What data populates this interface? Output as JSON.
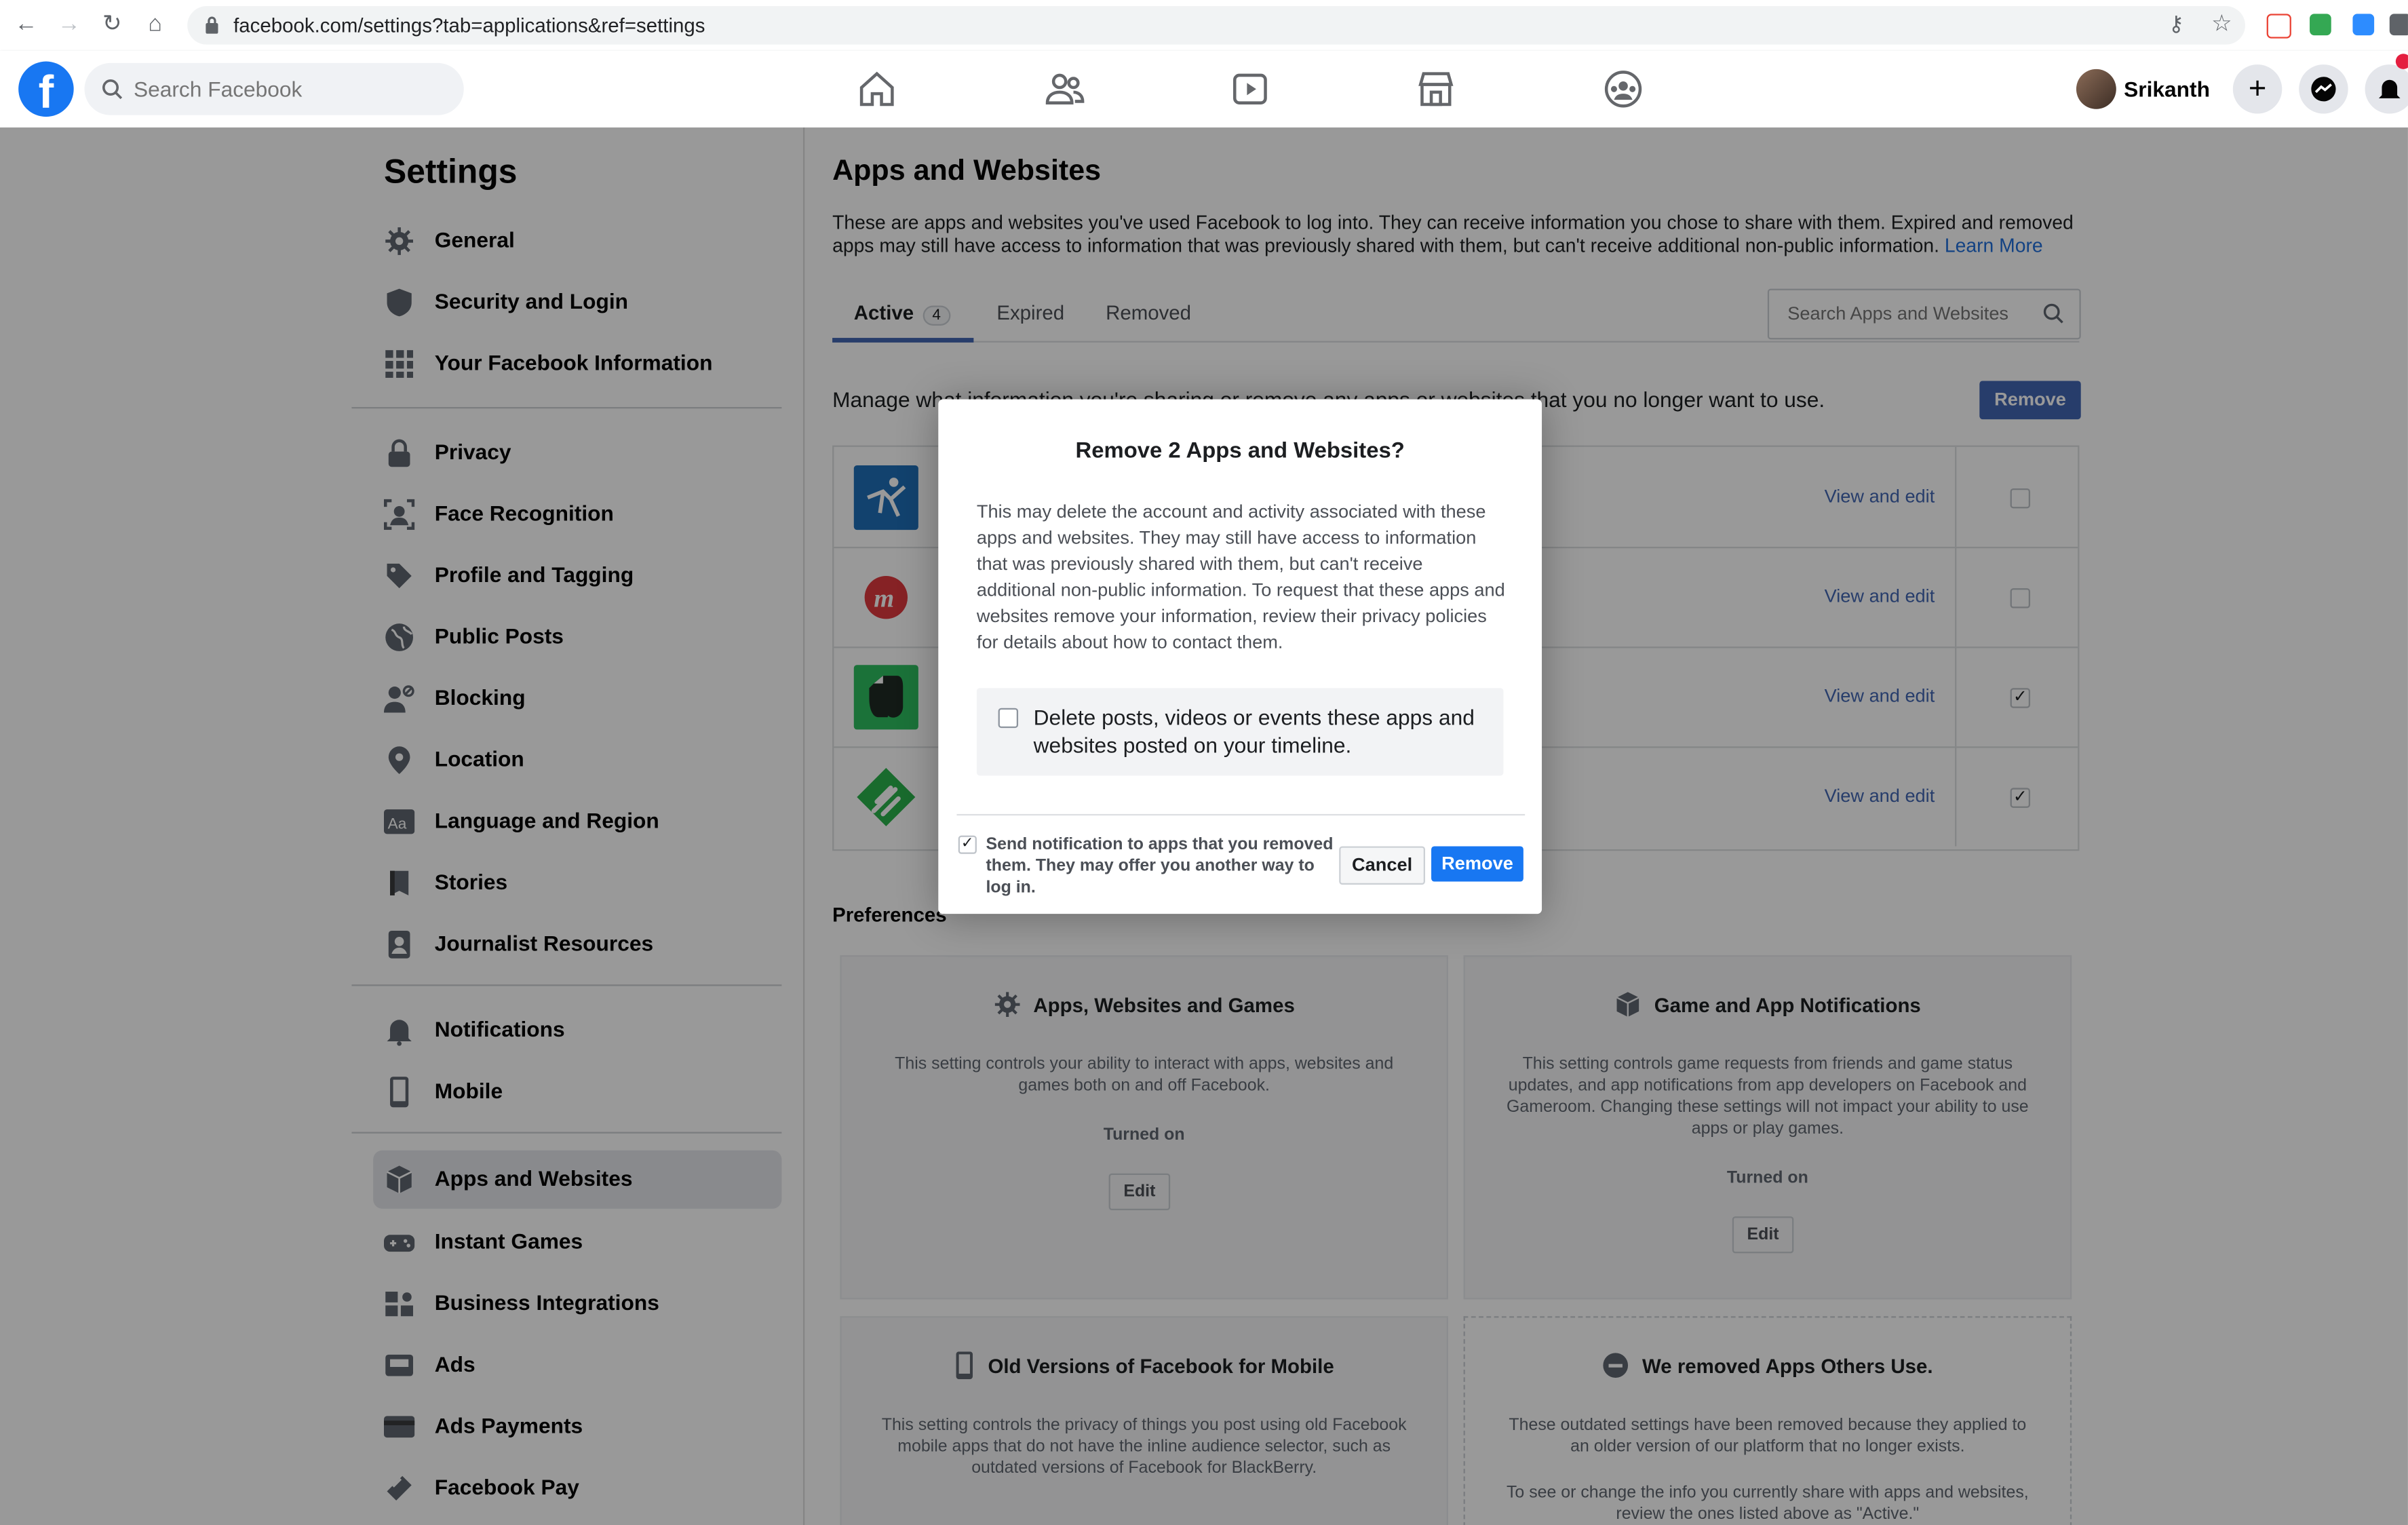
{
  "browser": {
    "url": "facebook.com/settings?tab=applications&ref=settings",
    "back_icon": "←",
    "forward_icon": "→",
    "reload_icon": "↻",
    "home_icon": "⌂",
    "star_icon": "☆",
    "key_icon": "⚷"
  },
  "header": {
    "logo": "f",
    "search_placeholder": "Search Facebook",
    "profile_name": "Srikanth",
    "plus": "+"
  },
  "sidebar": {
    "title": "Settings",
    "items": [
      {
        "label": "General"
      },
      {
        "label": "Security and Login"
      },
      {
        "label": "Your Facebook Information"
      },
      {
        "label": "Privacy"
      },
      {
        "label": "Face Recognition"
      },
      {
        "label": "Profile and Tagging"
      },
      {
        "label": "Public Posts"
      },
      {
        "label": "Blocking"
      },
      {
        "label": "Location"
      },
      {
        "label": "Language and Region"
      },
      {
        "label": "Stories"
      },
      {
        "label": "Journalist Resources"
      },
      {
        "label": "Notifications"
      },
      {
        "label": "Mobile"
      },
      {
        "label": "Apps and Websites"
      },
      {
        "label": "Instant Games"
      },
      {
        "label": "Business Integrations"
      },
      {
        "label": "Ads"
      },
      {
        "label": "Ads Payments"
      },
      {
        "label": "Facebook Pay"
      }
    ]
  },
  "main": {
    "title": "Apps and Websites",
    "description": "These are apps and websites you've used Facebook to log into. They can receive information you chose to share with them. Expired and removed apps may still have access to information that was previously shared with them, but can't receive additional non-public information.",
    "learn_more": "Learn More",
    "tabs": [
      {
        "label": "Active",
        "count": "4"
      },
      {
        "label": "Expired"
      },
      {
        "label": "Removed"
      }
    ],
    "search_placeholder": "Search Apps and Websites",
    "manage_text": "Manage what information you're sharing or remove any apps or websites that you no longer want to use.",
    "remove_label": "Remove",
    "apps": [
      {
        "view_edit": "View and edit",
        "checked": false,
        "icon": "runner-app-icon",
        "color": "#1f6fb8"
      },
      {
        "view_edit": "View and edit",
        "checked": false,
        "icon": "meetup-app-icon",
        "color": "#e0393e"
      },
      {
        "view_edit": "View and edit",
        "checked": true,
        "icon": "evernote-app-icon",
        "color": "#2dbe60"
      },
      {
        "view_edit": "View and edit",
        "checked": true,
        "icon": "feedly-app-icon",
        "color": "#2bb24c"
      }
    ],
    "check_mark": "✓",
    "preferences_title": "Preferences",
    "cards": [
      {
        "title": "Apps, Websites and Games",
        "desc": "This setting controls your ability to interact with apps, websites and games both on and off Facebook.",
        "status": "Turned on",
        "button": "Edit"
      },
      {
        "title": "Game and App Notifications",
        "desc": "This setting controls game requests from friends and game status updates, and app notifications from app developers on Facebook and Gameroom. Changing these settings will not impact your ability to use apps or play games.",
        "status": "Turned on",
        "button": "Edit"
      },
      {
        "title": "Old Versions of Facebook for Mobile",
        "desc": "This setting controls the privacy of things you post using old Facebook mobile apps that do not have the inline audience selector, such as outdated versions of Facebook for BlackBerry."
      },
      {
        "title": "We removed Apps Others Use.",
        "desc": "These outdated settings have been removed because they applied to an older version of our platform that no longer exists.",
        "desc2": "To see or change the info you currently share with apps and websites, review the ones listed above as \"Active.\""
      }
    ]
  },
  "modal": {
    "title": "Remove 2 Apps and Websites?",
    "body": "This may delete the account and activity associated with these apps and websites. They may still have access to information that was previously shared with them, but can't receive additional non-public information. To request that these apps and websites remove your information, review their privacy policies for details about how to contact them.",
    "delete_option": "Delete posts, videos or events these apps and websites posted on your timeline.",
    "notify_option": "Send notification to apps that you removed them. They may offer you another way to log in.",
    "cancel_label": "Cancel",
    "remove_label": "Remove",
    "check_mark": "✓"
  },
  "colors": {
    "brand": "#1877f2",
    "link": "#4267b2"
  }
}
